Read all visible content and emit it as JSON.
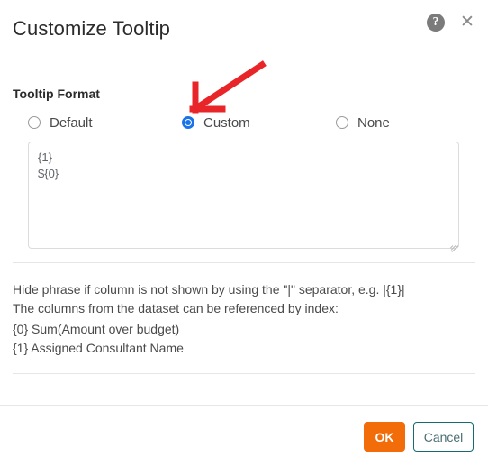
{
  "dialog": {
    "title": "Customize Tooltip",
    "help_icon": "help-circle-icon",
    "close_icon": "close-icon"
  },
  "format_section": {
    "label": "Tooltip Format",
    "options": [
      {
        "label": "Default",
        "selected": false
      },
      {
        "label": "Custom",
        "selected": true
      },
      {
        "label": "None",
        "selected": false
      }
    ],
    "textarea": {
      "value": "{1}\n${0}",
      "placeholder": ""
    }
  },
  "help": {
    "lines": [
      "Hide phrase if column is not shown by using the \"|\" separator, e.g. |{1}|",
      "The columns from the dataset can be referenced by index:"
    ],
    "columns": [
      "{0} Sum(Amount over budget)",
      "{1} Assigned Consultant Name"
    ]
  },
  "footer": {
    "ok_label": "OK",
    "cancel_label": "Cancel"
  },
  "annotation": {
    "type": "red-arrow",
    "points_to": "Custom",
    "color": "#e8262a"
  },
  "colors": {
    "accent_orange": "#f36c0a",
    "cancel_border_teal": "#176a72",
    "radio_blue": "#1a73e8",
    "annotation_red": "#e8262a",
    "divider_gray": "#e6e6e6"
  }
}
